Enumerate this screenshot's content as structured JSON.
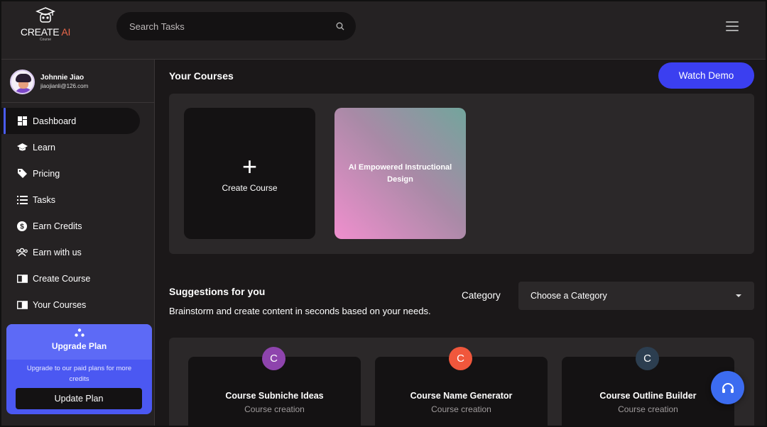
{
  "brand": {
    "name_main": "CREATE",
    "name_accent": "AI",
    "tagline": "Course"
  },
  "search": {
    "placeholder": "Search Tasks"
  },
  "user": {
    "name": "Johnnie Jiao",
    "email": "jiaojianli@126.com"
  },
  "sidebar": {
    "items": [
      {
        "label": "Dashboard",
        "icon": "dashboard-icon",
        "active": true
      },
      {
        "label": "Learn",
        "icon": "graduation-cap-icon"
      },
      {
        "label": "Pricing",
        "icon": "tag-icon"
      },
      {
        "label": "Tasks",
        "icon": "list-icon"
      },
      {
        "label": "Earn Credits",
        "icon": "dollar-circle-icon"
      },
      {
        "label": "Earn with us",
        "icon": "users-icon"
      },
      {
        "label": "Create Course",
        "icon": "book-open-icon"
      },
      {
        "label": "Your Courses",
        "icon": "book-open-icon"
      }
    ]
  },
  "upgrade": {
    "title": "Upgrade Plan",
    "description": "Upgrade to our paid plans for more credits",
    "button_label": "Update Plan",
    "icon": "nodes-icon"
  },
  "courses": {
    "title": "Your Courses",
    "watch_demo_label": "Watch Demo",
    "create_label": "Create Course",
    "items": [
      {
        "title": "AI Empowered Instructional Design"
      }
    ]
  },
  "suggestions": {
    "title": "Suggestions for you",
    "description": "Brainstorm and create content in seconds based on your needs.",
    "category_label": "Category",
    "category_select_value": "Choose a Category",
    "tools": [
      {
        "badge": "C",
        "badge_color": "#8e44ad",
        "title": "Course Subniche Ideas",
        "subtitle": "Course creation"
      },
      {
        "badge": "C",
        "badge_color": "#f0573c",
        "title": "Course Name Generator",
        "subtitle": "Course creation"
      },
      {
        "badge": "C",
        "badge_color": "#2c3e50",
        "title": "Course Outline Builder",
        "subtitle": "Course creation"
      }
    ]
  },
  "colors": {
    "accent": "#3b3ff0",
    "upgrade_bg": "#4b58f2",
    "panel_bg": "#2b2829",
    "card_bg": "#141213"
  }
}
